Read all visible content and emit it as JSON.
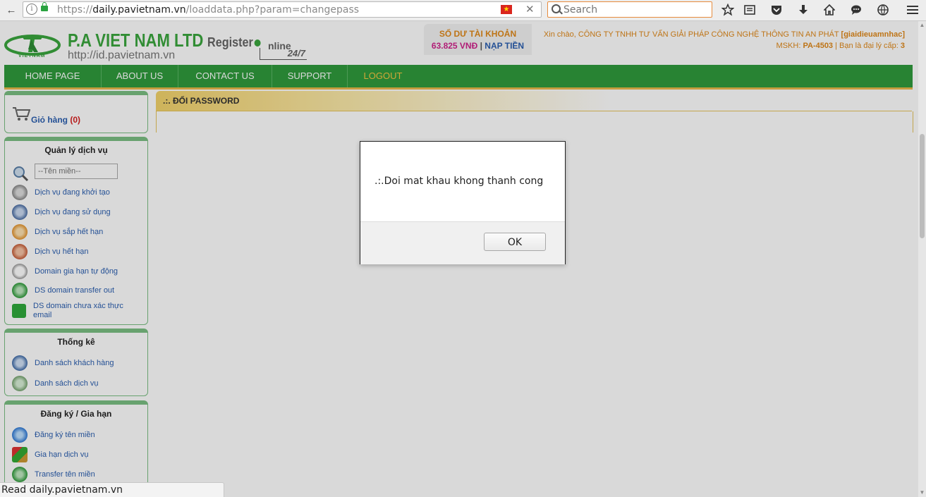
{
  "browser": {
    "url_prefix": "https://",
    "url_host": "daily.pavietnam.vn",
    "url_path": "/loaddata.php?param=changepass",
    "search_placeholder": "Search",
    "info_glyph": "i",
    "flag_glyph": "★",
    "clear_glyph": "✕",
    "icons": [
      "bookmark-star-icon",
      "reading-list-icon",
      "pocket-icon",
      "download-icon",
      "home-icon",
      "chat-icon",
      "globe-icon",
      "menu-icon"
    ]
  },
  "site": {
    "logo_caption": "VIETNAM",
    "brand": "P.A VIET NAM LTD",
    "brand_url": "http://id.pavietnam.vn",
    "register": "Register",
    "register_online": "nline",
    "register_247": "24/7"
  },
  "account": {
    "title": "SỐ DƯ TÀI KHOẢN",
    "balance": "63.825 VNĐ",
    "sep": " | ",
    "topup": "NẠP TIỀN",
    "greeting": "Xin chào, CÔNG TY TNHH TƯ VẤN GIẢI PHÁP CÔNG NGHỆ THÔNG TIN AN PHÁT",
    "username": "[giaidieuamnhac]",
    "mskh_label": "MSKH: ",
    "mskh": "PA-4503",
    "level_label": " | Bạn là đại lý cấp: ",
    "level": "3"
  },
  "menu": [
    "HOME PAGE",
    "ABOUT US",
    "CONTACT US",
    "SUPPORT",
    "LOGOUT"
  ],
  "cart": {
    "label": "Giỏ hàng",
    "count": "(0)"
  },
  "service_mgmt": {
    "title": "Quản lý dịch vụ",
    "domain_placeholder": "--Tên miền--",
    "items": [
      "Dịch vụ đang khởi tạo",
      "Dịch vụ đang sử dụng",
      "Dịch vụ sắp hết hạn",
      "Dịch vụ hết hạn",
      "Domain gia hạn tự động",
      "DS domain transfer out",
      "DS domain chưa xác thực email"
    ]
  },
  "stats": {
    "title": "Thống kê",
    "items": [
      "Danh sách khách hàng",
      "Danh sách dịch vụ"
    ]
  },
  "register_renew": {
    "title": "Đăng ký / Gia hạn",
    "items": [
      "Đăng ký tên miền",
      "Gia hạn dịch vụ",
      "Transfer tên miền"
    ]
  },
  "content": {
    "title": ".:. ĐỔI PASSWORD"
  },
  "dialog": {
    "message": ".:.Doi mat khau khong thanh cong",
    "ok": "OK"
  },
  "status": "Read daily.pavietnam.vn"
}
